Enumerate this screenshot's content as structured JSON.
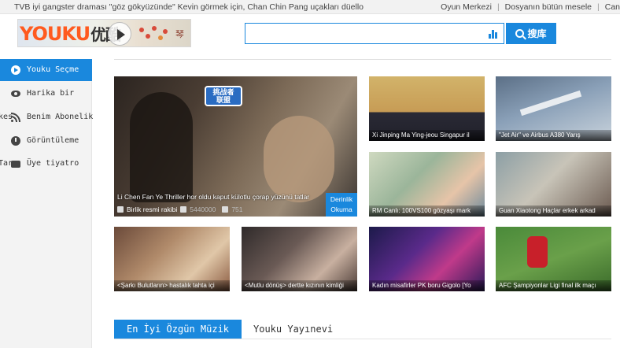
{
  "topbar": {
    "news": "TVB iyi gangster draması \"göz gökyüzünde\" Kevin görmek için, Chan Chin Pang uçakları düello",
    "links": [
      "Oyun Merkezi",
      "Dosyanın bütün mesele",
      "Can"
    ]
  },
  "header": {
    "logo_main": "YOUKU",
    "logo_cn": "优酷",
    "logo_stamp": "琴",
    "search_value": "",
    "search_button": "搜库"
  },
  "sidebar": {
    "items": [
      {
        "label": "Youku Seçme",
        "icon": "play-circle-icon",
        "prefix": ""
      },
      {
        "label": "Harika bir",
        "icon": "eye-icon",
        "prefix": ""
      },
      {
        "label": "Benim Abonelik",
        "icon": "rss-icon",
        "prefix": "kes"
      },
      {
        "label": "Görüntüleme",
        "icon": "clock-icon",
        "prefix": ""
      },
      {
        "label": "Üye tiyatro",
        "icon": "ticket-icon",
        "prefix": "Tar"
      }
    ]
  },
  "featured": {
    "title": "Li Chen Fan Ye Thriller hor oldu kaput külotlu çorap yüzünü tatlar",
    "channel": "Birlik resmi rakibi",
    "views": "5440000",
    "comments": "751",
    "deep_read": "Derinlik Okuma",
    "tv_logo_top": "挑战者",
    "tv_logo_bottom": "联盟"
  },
  "tiles": [
    {
      "caption": "Xi Jinping Ma Ying-jeou Singapur il"
    },
    {
      "caption": "\"Jet Air\" ve Airbus A380 Yarış"
    },
    {
      "caption": "RM Canlı: 100VS100 gözyaşı mark"
    },
    {
      "caption": "Guan Xiaotong Haçlar erkek arkad"
    },
    {
      "caption": "<Şarkı Bulutların> hastalık tahta içi"
    },
    {
      "caption": "<Mutlu dönüş> dertte kızının kimliği"
    },
    {
      "caption": "Kadın misafirler PK boru Gigolo [Yo"
    },
    {
      "caption": "AFC Şampiyonlar Ligi final ilk maçı"
    }
  ],
  "sections": {
    "active_tab": "En İyi Özgün Müzik",
    "tab2": "Youku Yayınevi"
  },
  "colors": {
    "accent": "#1a88dd",
    "logo_orange": "#ff5a1f",
    "logo_blue": "#2f8fd8"
  }
}
